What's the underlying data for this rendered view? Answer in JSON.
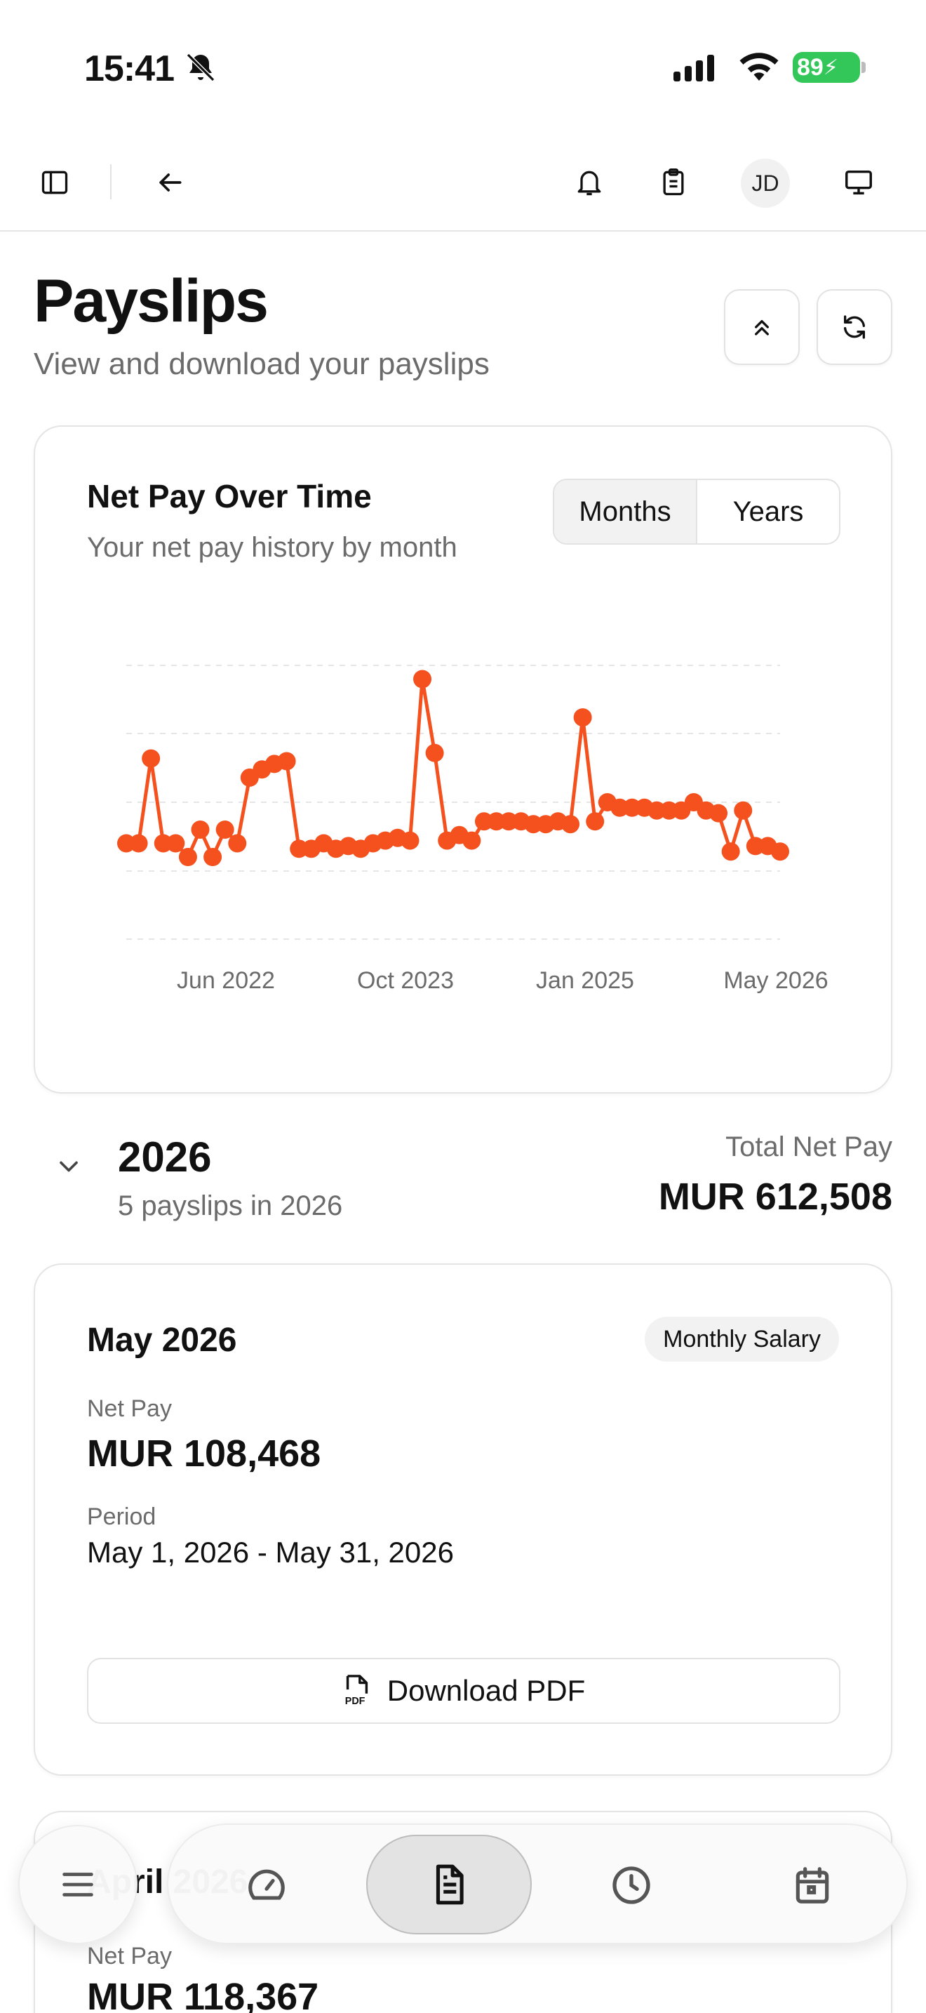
{
  "status_bar": {
    "time": "15:41",
    "battery": "89"
  },
  "toolbar": {
    "sidebar_icon": "sidebar-toggle-icon",
    "back_icon": "arrow-left-icon",
    "bell_icon": "bell-icon",
    "clipboard_icon": "clipboard-icon",
    "avatar_initials": "JD",
    "monitor_icon": "monitor-icon"
  },
  "header": {
    "title": "Payslips",
    "subtitle": "View and download your payslips"
  },
  "chart_card": {
    "title": "Net Pay Over Time",
    "subtitle": "Your net pay history by month",
    "toggle": {
      "months": "Months",
      "years": "Years",
      "active": "months"
    }
  },
  "chart_data": {
    "type": "line",
    "color": "#f4511e",
    "x_tick_labels": [
      "Jun 2022",
      "Oct 2023",
      "Jan 2025",
      "May 2026"
    ],
    "x_range": [
      "Jan 2022",
      "May 2026"
    ],
    "grid": "horizontal-dashed",
    "ylim": [
      0,
      1
    ],
    "values": [
      0.35,
      0.35,
      0.66,
      0.35,
      0.35,
      0.3,
      0.4,
      0.3,
      0.4,
      0.35,
      0.59,
      0.62,
      0.64,
      0.65,
      0.33,
      0.33,
      0.35,
      0.33,
      0.34,
      0.33,
      0.35,
      0.36,
      0.37,
      0.36,
      0.95,
      0.68,
      0.36,
      0.38,
      0.36,
      0.43,
      0.43,
      0.43,
      0.43,
      0.42,
      0.42,
      0.43,
      0.42,
      0.81,
      0.43,
      0.5,
      0.48,
      0.48,
      0.48,
      0.47,
      0.47,
      0.47,
      0.5,
      0.47,
      0.46,
      0.32,
      0.47,
      0.34,
      0.34,
      0.32
    ]
  },
  "year_section": {
    "year": "2026",
    "count_text": "5 payslips in 2026",
    "total_label": "Total Net Pay",
    "total_value": "MUR 612,508"
  },
  "payslips": [
    {
      "month": "May 2026",
      "type": "Monthly Salary",
      "net_pay_label": "Net Pay",
      "net_pay": "MUR 108,468",
      "period_label": "Period",
      "period": "May 1, 2026 - May 31, 2026",
      "download_label": "Download PDF"
    },
    {
      "month": "April 2026",
      "net_pay_label": "Net Pay",
      "net_pay": "MUR 118,367"
    }
  ],
  "bottom_nav": {
    "items": [
      "menu-icon",
      "dashboard-gauge-icon",
      "payslip-document-icon",
      "clock-icon",
      "calendar-icon"
    ],
    "active": "payslip-document-icon"
  }
}
